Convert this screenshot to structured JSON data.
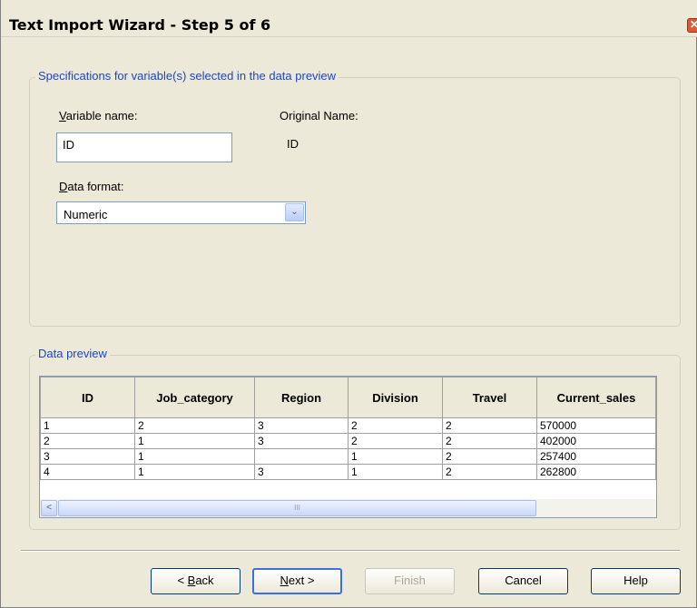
{
  "window": {
    "title": "Text Import Wizard - Step 5 of 6",
    "close_glyph": "✕"
  },
  "spec_group": {
    "legend": "Specifications for variable(s) selected in the data preview",
    "variable_name_label_mnemonic": "V",
    "variable_name_label_rest": "ariable name:",
    "variable_name_value": "ID",
    "original_name_label": "Original Name:",
    "original_name_value": "ID",
    "data_format_label_mnemonic": "D",
    "data_format_label_rest": "ata format:",
    "data_format_value": "Numeric"
  },
  "preview_group": {
    "legend": "Data preview",
    "columns": [
      "ID",
      "Job_category",
      "Region",
      "Division",
      "Travel",
      "Current_sales"
    ],
    "rows": [
      [
        "1",
        "2",
        "3",
        "2",
        "2",
        "570000"
      ],
      [
        "2",
        "1",
        "3",
        "2",
        "2",
        "402000"
      ],
      [
        "3",
        "1",
        "",
        "1",
        "2",
        "257400"
      ],
      [
        "4",
        "1",
        "3",
        "1",
        "2",
        "262800"
      ]
    ]
  },
  "buttons": {
    "back_prefix": "< ",
    "back_mnemonic": "B",
    "back_rest": "ack",
    "next_mnemonic": "N",
    "next_rest": "ext >",
    "finish": "Finish",
    "cancel": "Cancel",
    "help": "Help"
  },
  "scroll_glyphs": {
    "up": "⌃",
    "down": "⌄",
    "left": "<",
    "right": ">",
    "thumb_grip": "III"
  }
}
